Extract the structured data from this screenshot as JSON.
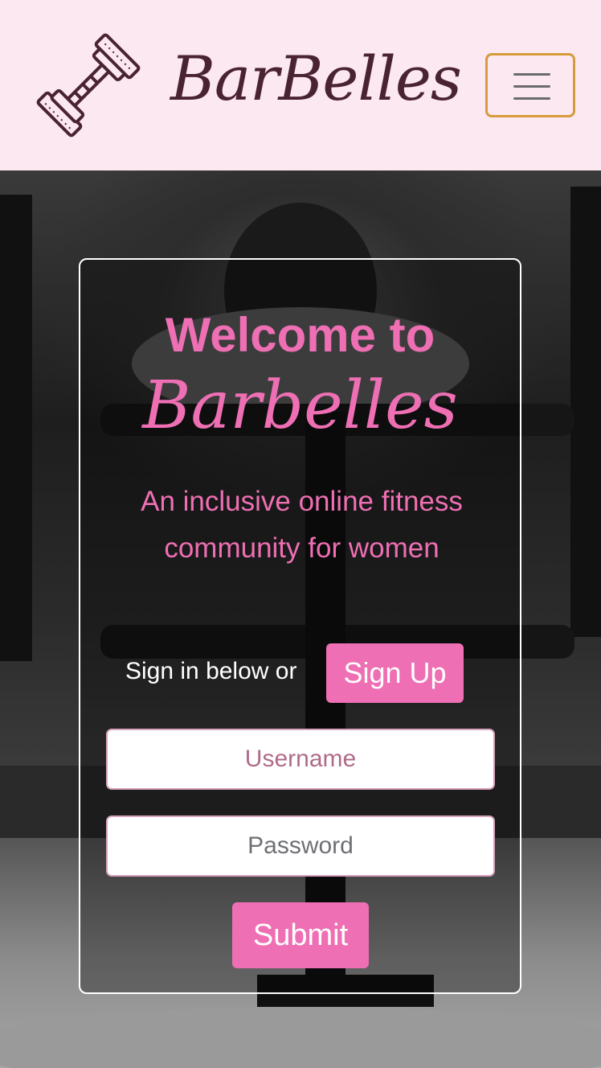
{
  "navbar": {
    "brand": "BarBelles",
    "logo_icon": "dumbbell-icon",
    "menu_icon": "hamburger-menu-icon"
  },
  "hero": {
    "background": "black-and-white gym photo"
  },
  "card": {
    "welcome": "Welcome to",
    "brand": "Barbelles",
    "tagline": "An inclusive online fitness community for women",
    "signin_prompt": "Sign in below or",
    "signup_label": "Sign Up",
    "username_placeholder": "Username",
    "password_placeholder": "Password",
    "submit_label": "Submit"
  },
  "colors": {
    "navbar_bg": "#fce8f1",
    "brand_text": "#4a2332",
    "accent_pink": "#ee6fb3",
    "toggle_border": "#d79b3c"
  }
}
